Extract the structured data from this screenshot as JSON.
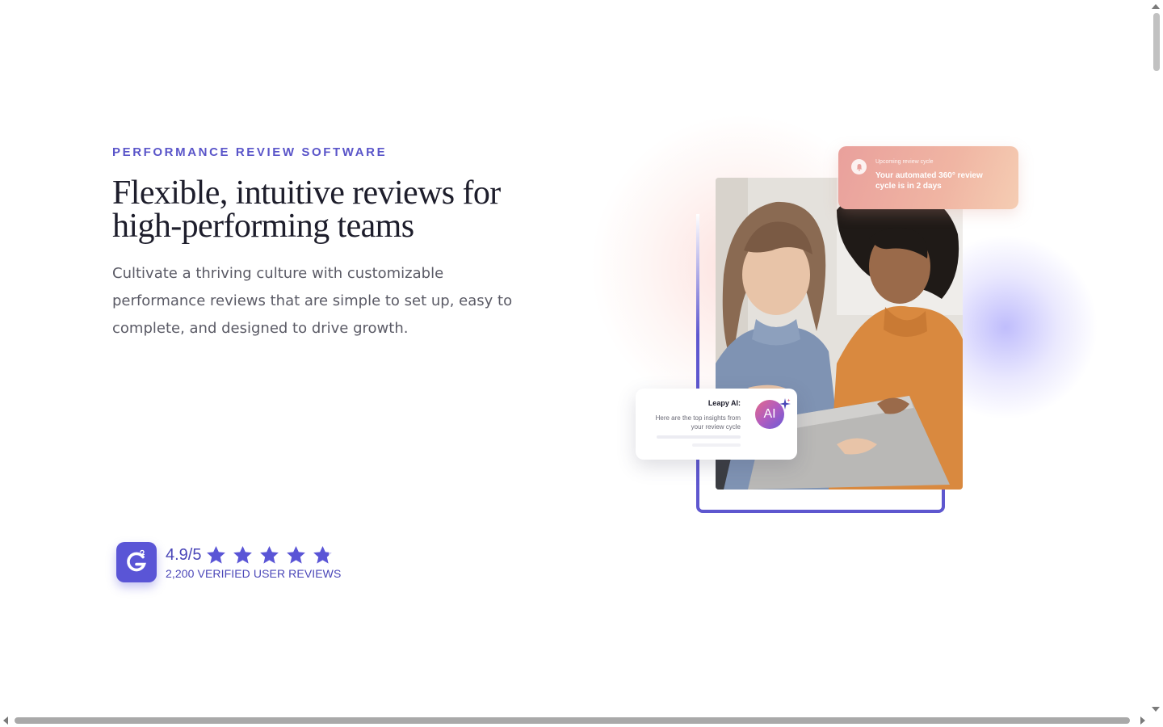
{
  "hero": {
    "eyebrow": "PERFORMANCE REVIEW SOFTWARE",
    "headline_line1": "Flexible, intuitive reviews for",
    "headline_line2": "high-performing teams",
    "subhead": "Cultivate a thriving culture with customizable performance reviews that are simple to set up, easy to complete, and designed to drive growth."
  },
  "rating": {
    "badge_icon": "g2-logo-icon",
    "score": "4.9/5",
    "stars": 4.9,
    "star_count": 5,
    "reviews_label": "2,200 VERIFIED USER REVIEWS"
  },
  "visual": {
    "notification": {
      "overline": "Upcoming review cycle",
      "body": "Your automated 360° review cycle is in 2 days"
    },
    "ai_card": {
      "title": "Leapy AI:",
      "text": "Here are the top insights from your review cycle",
      "avatar_label": "AI"
    },
    "photo_alt": "two-colleagues-reviewing-laptop"
  },
  "colors": {
    "accent": "#5a55d6",
    "eyebrow": "#5a55c9",
    "headline": "#1d1d2b",
    "body_text": "#5b5b66",
    "frame": "#5e57cf"
  }
}
